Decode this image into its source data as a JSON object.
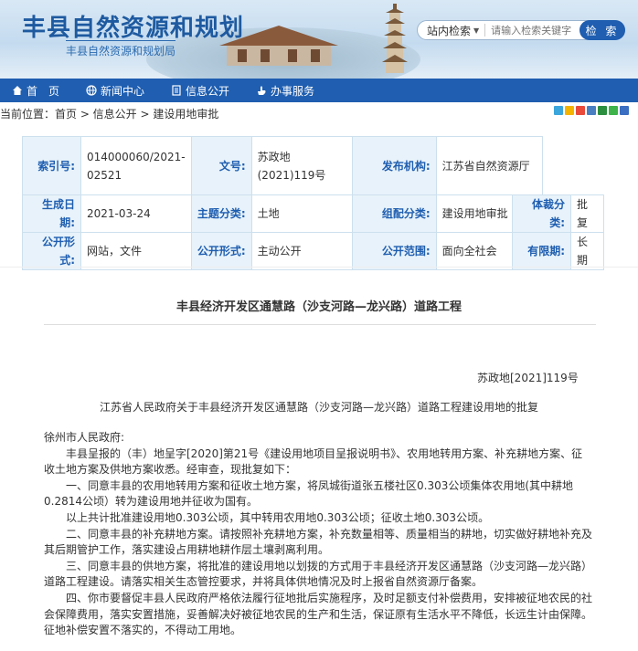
{
  "header": {
    "site_title": "丰县自然资源和规划",
    "site_subtitle": "丰县自然资源和规划局",
    "search": {
      "scope": "站内检索",
      "placeholder": "请输入检索关键字",
      "button": "检 索"
    }
  },
  "nav": {
    "items": [
      {
        "label": "首　页",
        "icon": "home-icon"
      },
      {
        "label": "新闻中心",
        "icon": "globe-icon"
      },
      {
        "label": "信息公开",
        "icon": "document-icon"
      },
      {
        "label": "办事服务",
        "icon": "hand-icon"
      }
    ]
  },
  "breadcrumb": {
    "text": "当前位置：首页 > 信息公开 > 建设用地审批"
  },
  "share": {
    "icons": [
      "share-plus-icon",
      "qzone-icon",
      "weibo-icon",
      "renren-icon",
      "douban-icon",
      "wechat-icon",
      "more-icon"
    ],
    "colors": [
      "#3aa6dc",
      "#f4b400",
      "#e94a3a",
      "#4a7fc1",
      "#2c8f3f",
      "#3db34a",
      "#3a6fc1"
    ]
  },
  "meta": {
    "index_label": "索引号:",
    "index_value": "014000060/2021-02521",
    "docno_label": "文号:",
    "docno_value": "苏政地(2021)119号",
    "issuer_label": "发布机构:",
    "issuer_value": "江苏省自然资源厅",
    "date_label": "生成日期:",
    "date_value": "2021-03-24",
    "topic_label": "主题分类:",
    "topic_value": "土地",
    "org_label": "组配分类:",
    "org_value": "建设用地审批",
    "genre_label": "体裁分类:",
    "genre_value": "批复",
    "form_label": "公开形式:",
    "form_value": "网站，文件",
    "mode_label": "公开形式:",
    "mode_value": "主动公开",
    "range_label": "公开范围:",
    "range_value": "面向全社会",
    "period_label": "有限期:",
    "period_value": "长期"
  },
  "article": {
    "title": "丰县经济开发区通慧路（沙支河路—龙兴路）道路工程",
    "doc_number": "苏政地[2021]119号",
    "doc_heading": "江苏省人民政府关于丰县经济开发区通慧路（沙支河路—龙兴路）道路工程建设用地的批复",
    "addressee": "徐州市人民政府:",
    "paragraphs": [
      "丰县呈报的（丰）地呈字[2020]第21号《建设用地项目呈报说明书》、农用地转用方案、补充耕地方案、征收土地方案及供地方案收悉。经审查，现批复如下：",
      "一、同意丰县的农用地转用方案和征收土地方案，将凤城街道张五楼社区0.303公顷集体农用地(其中耕地0.2814公顷）转为建设用地并征收为国有。",
      "以上共计批准建设用地0.303公顷，其中转用农用地0.303公顷；征收土地0.303公顷。",
      "二、同意丰县的补充耕地方案。请按照补充耕地方案，补充数量相等、质量相当的耕地，切实做好耕地补充及其后期管护工作，落实建设占用耕地耕作层土壤剥离利用。",
      "三、同意丰县的供地方案，将批准的建设用地以划拨的方式用于丰县经济开发区通慧路（沙支河路—龙兴路）道路工程建设。请落实相关生态管控要求，并将具体供地情况及时上报省自然资源厅备案。",
      "四、你市要督促丰县人民政府严格依法履行征地批后实施程序，及时足额支付补偿费用，安排被征地农民的社会保障费用，落实安置措施，妥善解决好被征地农民的生产和生活，保证原有生活水平不降低，长远生计由保障。征地补偿安置不落实的，不得动工用地。"
    ]
  }
}
